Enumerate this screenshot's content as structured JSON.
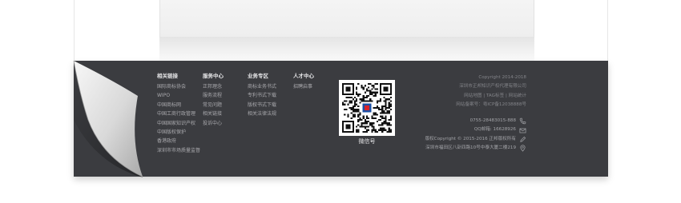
{
  "footer": {
    "columns": [
      {
        "title": "相关链接",
        "items": [
          "国际商标协会",
          "WIPO",
          "中国商标网",
          "中国工商行政管理",
          "中国国家知识产权",
          "中国版权保护",
          "香港政府",
          "深圳市市场质量监督"
        ]
      },
      {
        "title": "服务中心",
        "items": [
          "正邦理念",
          "服务流程",
          "常见问题",
          "相关链接",
          "投诉中心"
        ]
      },
      {
        "title": "业务专区",
        "items": [
          "商标业务书式",
          "专利书式下载",
          "版权书式下载",
          "相关法律法规"
        ]
      },
      {
        "title": "人才中心",
        "items": [
          "招聘启事"
        ]
      }
    ],
    "qr": {
      "label": "微信号"
    },
    "right_info": [
      "Copyright 2014-2018",
      "深圳市正邦知识产权代理有限公司",
      "网站地图 | TAG标签 | 网站统计",
      "网站备案号：粤ICP备12038888号"
    ],
    "contact": {
      "phone": "0755-28483015-888",
      "qq": "QQ邮箱: 16628926",
      "copyright": "版权Copyright © 2015-2016 正邦版权所有",
      "address": "深圳市福田区八卦四路10号中泰大厦二楼219"
    }
  },
  "colors": {
    "footer_bg": "#3b3c40",
    "link": "#a9a9ad",
    "title": "#e6e6e8"
  }
}
